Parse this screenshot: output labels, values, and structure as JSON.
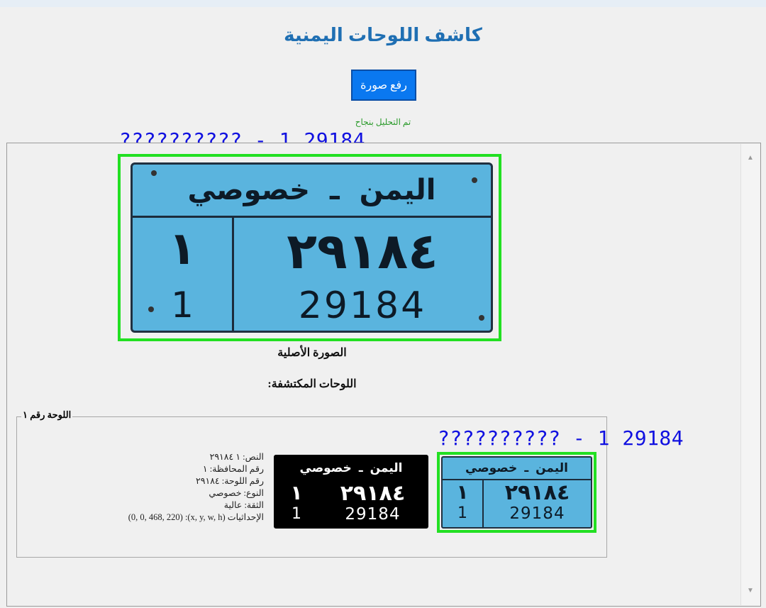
{
  "app": {
    "title": "كاشف اللوحات اليمنية",
    "upload_button": "رفع صورة",
    "status": "تم التحليل بنجاح"
  },
  "overlay_text": "?????????? - 1 29184",
  "plate": {
    "country": "اليمن",
    "separator": "ـ",
    "type_label": "خصوصي",
    "province_ar": "١",
    "number_ar": "٢٩١٨٤",
    "province_en": "1",
    "number_en": "29184"
  },
  "original_caption": "الصورة الأصلية",
  "detected_heading": "اللوحات المكتشفة:",
  "result": {
    "group_title": "اللوحة رقم ١",
    "lines": [
      "النص: ١ ٢٩١٨٤",
      "رقم المحافظة: ١",
      "رقم اللوحة: ٢٩١٨٤",
      "النوع: خصوصي",
      "الثقة: عالية",
      "الإحداثيات (x, y, w, h): (0, 0, 468, 220)"
    ]
  },
  "colors": {
    "accent": "#1f6fb3",
    "button": "#0a78f0",
    "status_green": "#2a9a2a",
    "detection_box": "#22e022",
    "overlay_text": "#1010e0",
    "plate_blue": "#5ab4de"
  }
}
